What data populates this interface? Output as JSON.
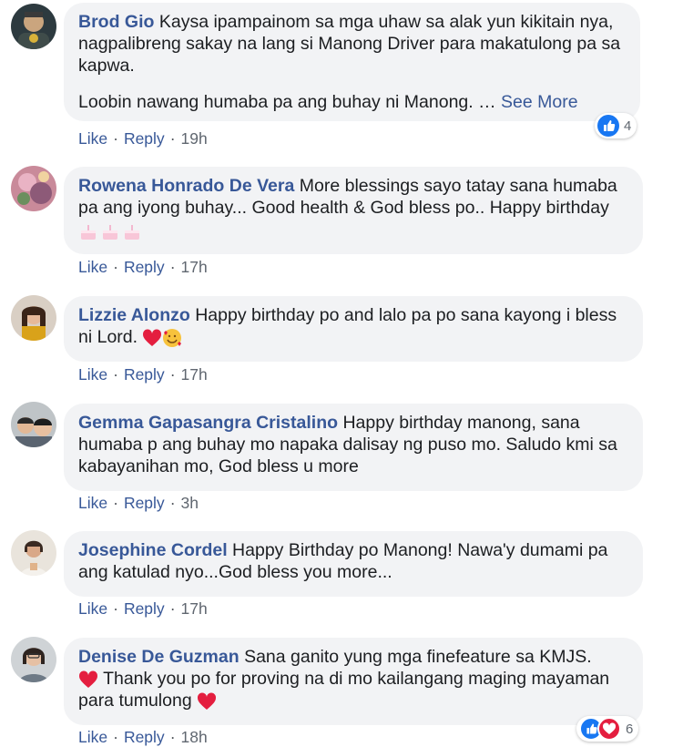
{
  "comments": [
    {
      "name": "Brod Gio",
      "text": "Kaysa ipampainom sa mga uhaw sa alak yun kikitain nya, nagpalibreng sakay na lang si Manong Driver para makatulong pa sa kapwa.",
      "text2": "Loobin nawang humaba pa ang buhay ni Manong. …",
      "see_more": "See More",
      "like": "Like",
      "reply": "Reply",
      "time": "19h",
      "reaction_count": "4"
    },
    {
      "name": "Rowena Honrado De Vera",
      "text": "More blessings sayo tatay sana humaba pa ang iyong buhay... Good health & God bless po.. Happy birthday",
      "like": "Like",
      "reply": "Reply",
      "time": "17h"
    },
    {
      "name": "Lizzie Alonzo",
      "text": "Happy birthday po and lalo pa po sana kayong i bless ni Lord.",
      "like": "Like",
      "reply": "Reply",
      "time": "17h"
    },
    {
      "name": "Gemma Gapasangra Cristalino",
      "text": "Happy birthday manong, sana humaba p ang buhay mo napaka dalisay ng puso mo. Saludo kmi sa kabayanihan mo, God bless u more",
      "like": "Like",
      "reply": "Reply",
      "time": "3h"
    },
    {
      "name": "Josephine Cordel",
      "text": "Happy Birthday po Manong! Nawa'y dumami pa ang katulad nyo...God bless you more...",
      "like": "Like",
      "reply": "Reply",
      "time": "17h"
    },
    {
      "name": "Denise De Guzman",
      "text": "Sana ganito yung mga finefeature sa KMJS.",
      "text2": "Thank you po for proving na di mo kailangang maging mayaman",
      "text3": "para tumulong",
      "like": "Like",
      "reply": "Reply",
      "time": "18h",
      "reaction_count": "6"
    }
  ],
  "icons": {
    "like_reaction": "like-reaction-icon",
    "love_reaction": "love-reaction-icon",
    "heart": "red-heart-emoji",
    "smiling_hearts": "smiling-face-with-hearts-emoji",
    "cake": "birthday-cake-emoji"
  },
  "colors": {
    "name": "#385898",
    "bubble": "#f2f3f5",
    "like_blue": "#1877f2",
    "heart_red": "#e41e3f"
  }
}
